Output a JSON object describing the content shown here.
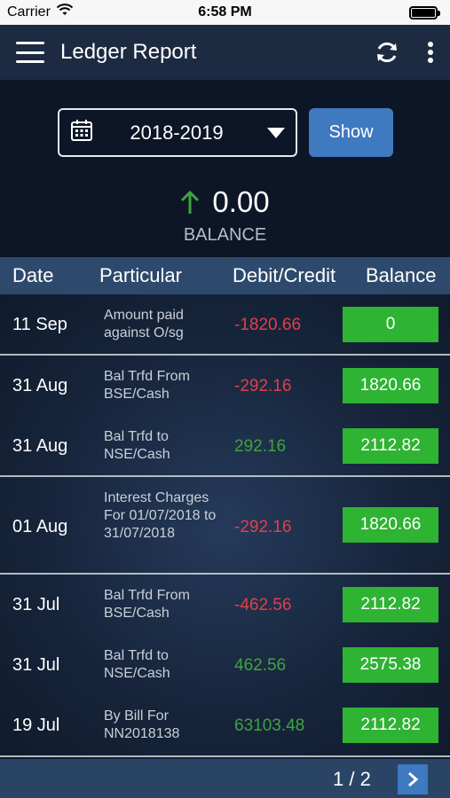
{
  "status_bar": {
    "carrier": "Carrier",
    "time": "6:58 PM"
  },
  "app_bar": {
    "title": "Ledger Report"
  },
  "filter": {
    "year": "2018-2019",
    "show_label": "Show"
  },
  "balance": {
    "value": "0.00",
    "label": "BALANCE"
  },
  "table": {
    "headers": {
      "date": "Date",
      "particular": "Particular",
      "debit_credit": "Debit/Credit",
      "balance": "Balance"
    },
    "rows": [
      {
        "date": "11 Sep",
        "particular": "Amount paid against O/sg",
        "amount": "-1820.66",
        "balance": "0"
      },
      {
        "date": "31 Aug",
        "particular": "Bal Trfd From BSE/Cash",
        "amount": "-292.16",
        "balance": "1820.66"
      },
      {
        "date": "31 Aug",
        "particular": "Bal Trfd to NSE/Cash",
        "amount": "292.16",
        "balance": "2112.82"
      },
      {
        "date": "01 Aug",
        "particular": "Interest Charges For 01/07/2018 to 31/07/2018",
        "amount": "-292.16",
        "balance": "1820.66"
      },
      {
        "date": "31 Jul",
        "particular": "Bal Trfd From BSE/Cash",
        "amount": "-462.56",
        "balance": "2112.82"
      },
      {
        "date": "31 Jul",
        "particular": "Bal Trfd to NSE/Cash",
        "amount": "462.56",
        "balance": "2575.38"
      },
      {
        "date": "19 Jul",
        "particular": "By Bill For NN2018138",
        "amount": "63103.48",
        "balance": "2112.82"
      }
    ]
  },
  "pagination": {
    "label": "1 / 2"
  },
  "colors": {
    "debit": "#e0404a",
    "credit": "#3fa33f",
    "balance_badge": "#2eb333",
    "accent": "#3f79bf"
  }
}
